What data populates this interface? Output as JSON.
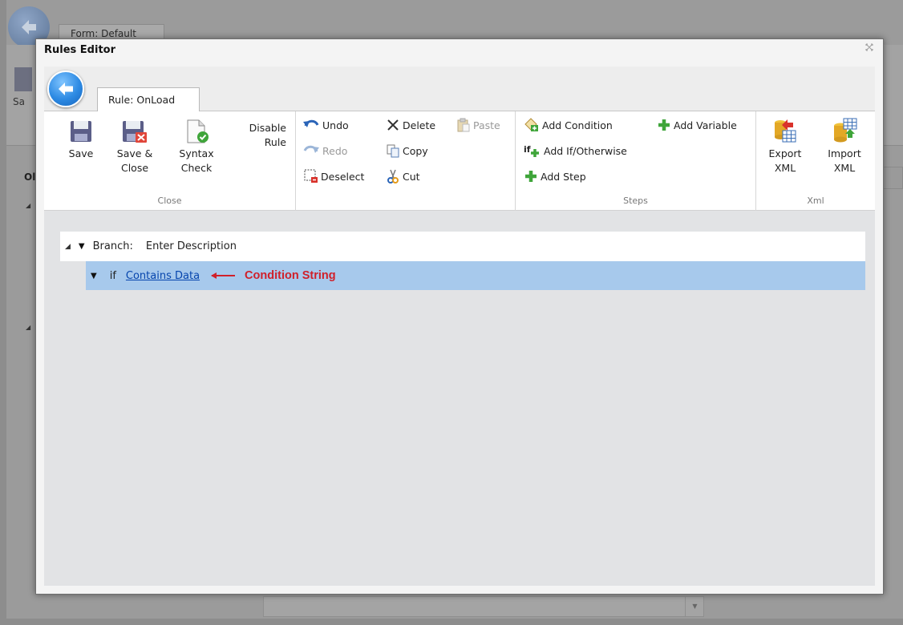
{
  "background_app": {
    "form_tab": "Form: Default",
    "save_label_partial": "Sa",
    "column_header_partial": "Ol"
  },
  "dialog": {
    "title": "Rules Editor",
    "close_icon": "close-icon",
    "rule_tab": "Rule: OnLoad"
  },
  "ribbon": {
    "close_group": {
      "label": "Close",
      "save": "Save",
      "save_close_line1": "Save &",
      "save_close_line2": "Close",
      "syntax_line1": "Syntax",
      "syntax_line2": "Check",
      "disable_line1": "Disable",
      "disable_line2": "Rule"
    },
    "edit_group": {
      "undo": "Undo",
      "redo": "Redo",
      "deselect": "Deselect",
      "delete": "Delete",
      "copy": "Copy",
      "cut": "Cut",
      "paste": "Paste"
    },
    "steps_group": {
      "label": "Steps",
      "add_condition": "Add Condition",
      "add_if_otherwise": "Add If/Otherwise",
      "add_step": "Add Step",
      "add_variable": "Add Variable"
    },
    "xml_group": {
      "label": "Xml",
      "export_line1": "Export",
      "export_line2": "XML",
      "import_line1": "Import",
      "import_line2": "XML"
    }
  },
  "tree": {
    "branch_label": "Branch:",
    "branch_description": "Enter Description",
    "if_keyword": "if",
    "condition_link": "Contains Data",
    "annotation": "Condition String"
  },
  "colors": {
    "selected_row": "#a7c9ec",
    "link": "#0645ad",
    "annotation": "#d0202a",
    "back_button": "#2d8ae3"
  }
}
